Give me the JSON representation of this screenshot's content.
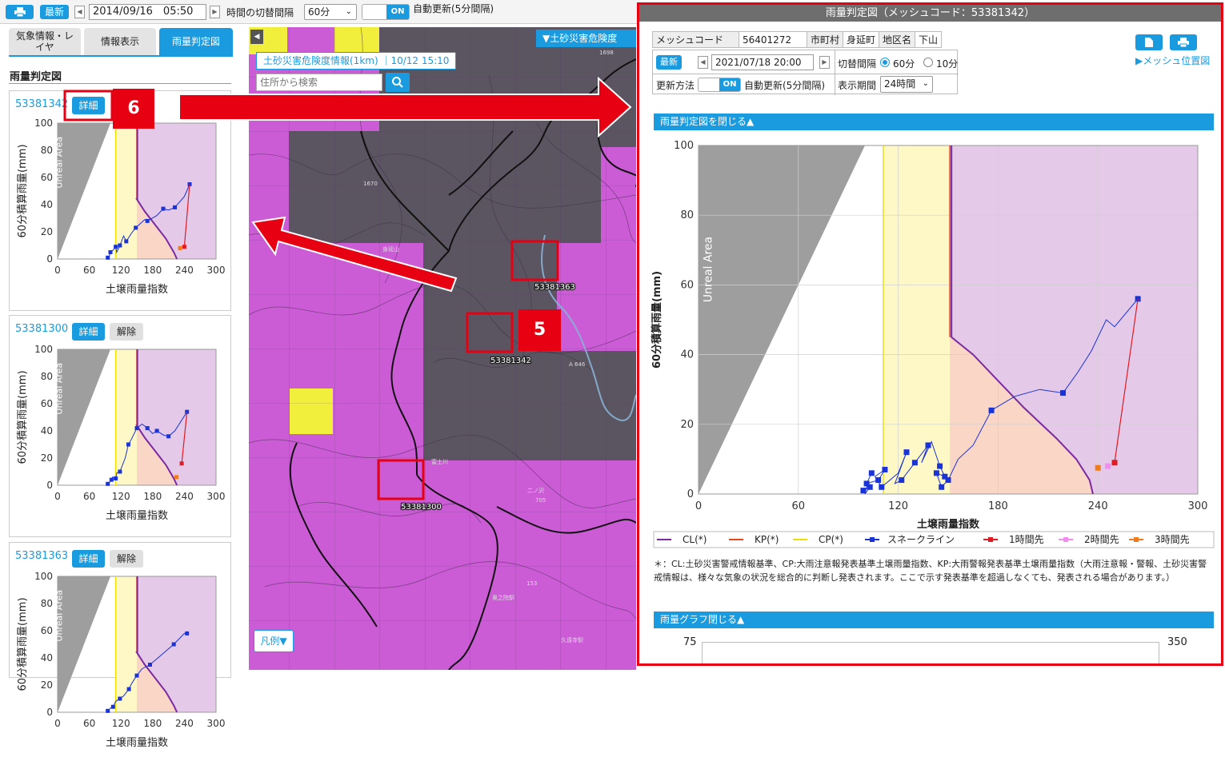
{
  "topbar": {
    "latest": "最新",
    "datetime": "2014/09/16　05:50",
    "interval_label": "時間の切替間隔",
    "interval_value": "60分",
    "toggle_on": "ON",
    "auto_update": "自動更新(5分間隔)"
  },
  "sidebar": {
    "tabs": [
      "気象情報・レイヤ",
      "情報表示",
      "雨量判定図"
    ],
    "section_title": "雨量判定図",
    "detail_label": "詳細",
    "release_label": "解除",
    "unreal_area": "Unreal Area",
    "ylabel": "60分積算雨量(mm)",
    "xlabel": "土壌雨量指数",
    "yticks": [
      "100",
      "80",
      "60",
      "40",
      "20",
      "0"
    ],
    "xticks": [
      "0",
      "60",
      "120",
      "180",
      "240",
      "300"
    ],
    "cards": [
      {
        "code": "53381342"
      },
      {
        "code": "53381300"
      },
      {
        "code": "53381363"
      }
    ]
  },
  "map": {
    "hazard_button": "▼土砂災害危険度",
    "info_label": "土砂災害危険度情報(1km) ｜10/12 15:10",
    "search_placeholder": "住所から検索",
    "legend_button": "凡例▼",
    "mesh_labels": [
      "53381363",
      "53381342",
      "53381300"
    ],
    "terrain_labels": [
      "1670",
      "1698",
      "A 646",
      "705",
      "153",
      "奥之院駅",
      "久遠寺駅",
      "身延山",
      "富士川",
      "二ノ沢"
    ],
    "colors": {
      "purple": "#cc5bd6",
      "dark": "#5a5560",
      "yellow": "#f2ee3c"
    }
  },
  "annotations": {
    "five": "5",
    "six": "6"
  },
  "panel": {
    "title": "雨量判定図（メッシュコード：53381342）",
    "mesh_code_label": "メッシュコード",
    "mesh_code_value": "56401272",
    "city_label": "市町村",
    "city_value": "身延町",
    "area_label": "地区名",
    "area_value": "下山",
    "latest": "最新",
    "datetime": "2021/07/18 20:00",
    "interval_label": "切替間隔",
    "interval_60": "60分",
    "interval_10": "10分",
    "update_label": "更新方法",
    "toggle_on": "ON",
    "auto_update": "自動更新(5分間隔)",
    "period_label": "表示期間",
    "period_value": "24時間",
    "mesh_position_link": "▶メッシュ位置図",
    "close_chart": "雨量判定図を閉じる▲",
    "close_graph": "雨量グラフ閉じる▲",
    "footnote": "＊：CL:土砂災害警戒情報基準、CP:大雨注意報発表基準土壌雨量指数、KP:大雨警報発表基準土壌雨量指数（大雨注意報・警報、土砂災害警戒情報は、様々な気象の状況を総合的に判断し発表されます。ここで示す発表基準を超過しなくても、発表される場合があります。）",
    "rain_graph_left_tick": "75",
    "rain_graph_right_tick": "350"
  },
  "chart_data": {
    "type": "line",
    "title": "",
    "xlabel": "土壌雨量指数",
    "ylabel": "60分積算雨量(mm)",
    "xlim": [
      0,
      300
    ],
    "ylim": [
      0,
      100
    ],
    "xticks": [
      0,
      60,
      120,
      180,
      240,
      300
    ],
    "yticks": [
      0,
      20,
      40,
      60,
      80,
      100
    ],
    "unreal_label": "Unreal Area",
    "cp_x": 111,
    "kp_x": 151,
    "cl_curve": [
      [
        152,
        45
      ],
      [
        165,
        40
      ],
      [
        177,
        34
      ],
      [
        195,
        25
      ],
      [
        215,
        16
      ],
      [
        227,
        10
      ],
      [
        235,
        4
      ],
      [
        237,
        0
      ]
    ],
    "snake_line": [
      [
        99,
        1
      ],
      [
        103,
        2
      ],
      [
        100,
        0
      ],
      [
        102,
        4
      ],
      [
        104,
        6
      ],
      [
        101,
        3
      ],
      [
        108,
        4
      ],
      [
        112,
        7
      ],
      [
        106,
        5
      ],
      [
        110,
        2
      ],
      [
        115,
        4
      ],
      [
        120,
        6
      ],
      [
        125,
        12
      ],
      [
        118,
        3
      ],
      [
        122,
        4
      ],
      [
        130,
        9
      ],
      [
        138,
        14
      ],
      [
        134,
        9
      ],
      [
        140,
        15
      ],
      [
        145,
        8
      ],
      [
        148,
        5
      ],
      [
        143,
        6
      ],
      [
        146,
        2
      ],
      [
        150,
        4
      ],
      [
        156,
        10
      ],
      [
        165,
        14
      ],
      [
        176,
        24
      ],
      [
        190,
        28
      ],
      [
        205,
        30
      ],
      [
        219,
        29
      ],
      [
        228,
        35
      ],
      [
        236,
        41
      ],
      [
        245,
        50
      ],
      [
        250,
        48
      ],
      [
        264,
        56
      ]
    ],
    "snake_markers": [
      [
        99,
        1
      ],
      [
        101,
        3
      ],
      [
        103,
        2
      ],
      [
        104,
        6
      ],
      [
        108,
        4
      ],
      [
        110,
        2
      ],
      [
        112,
        7
      ],
      [
        122,
        4
      ],
      [
        125,
        12
      ],
      [
        130,
        9
      ],
      [
        138,
        14
      ],
      [
        143,
        6
      ],
      [
        145,
        8
      ],
      [
        146,
        2
      ],
      [
        148,
        5
      ],
      [
        150,
        4
      ],
      [
        176,
        24
      ],
      [
        219,
        29
      ],
      [
        264,
        56
      ]
    ],
    "forecast_1h": [
      [
        264,
        56
      ],
      [
        250,
        9
      ]
    ],
    "forecast_2h": [
      [
        246,
        8
      ]
    ],
    "forecast_3h": [
      [
        240,
        7.5
      ]
    ],
    "legend": [
      "CL(*)",
      "KP(*)",
      "CP(*)",
      "スネークライン",
      "1時間先",
      "2時間先",
      "3時間先"
    ],
    "series_colors": {
      "CL": "#7b2aa0",
      "KP": "#e8471e",
      "CP": "#f0e000",
      "snake": "#1a33d6",
      "h1": "#e21a23",
      "h2": "#f28cf0",
      "h3": "#f07c1e",
      "unreal": "#9e9e9e",
      "cp_fill": "#fdf8c6",
      "kp_fill": "#f9d6c6",
      "cl_fill": "#e4c9e8"
    }
  },
  "mini_charts": [
    {
      "snake": [
        [
          95,
          1
        ],
        [
          98,
          2
        ],
        [
          100,
          5
        ],
        [
          104,
          6
        ],
        [
          110,
          9
        ],
        [
          112,
          5
        ],
        [
          118,
          10
        ],
        [
          125,
          17
        ],
        [
          130,
          13
        ],
        [
          140,
          19
        ],
        [
          148,
          23
        ],
        [
          165,
          29
        ],
        [
          170,
          28
        ],
        [
          188,
          32
        ],
        [
          200,
          37
        ],
        [
          210,
          36
        ],
        [
          222,
          38
        ],
        [
          240,
          46
        ],
        [
          250,
          55
        ]
      ],
      "h1": [
        [
          250,
          55
        ],
        [
          240,
          9
        ]
      ],
      "h3": [
        [
          232,
          8
        ]
      ]
    },
    {
      "snake": [
        [
          95,
          1
        ],
        [
          98,
          2
        ],
        [
          102,
          4
        ],
        [
          104,
          6
        ],
        [
          110,
          5
        ],
        [
          112,
          9
        ],
        [
          118,
          10
        ],
        [
          128,
          20
        ],
        [
          134,
          30
        ],
        [
          140,
          34
        ],
        [
          150,
          42
        ],
        [
          160,
          45
        ],
        [
          170,
          42
        ],
        [
          180,
          38
        ],
        [
          188,
          40
        ],
        [
          200,
          37
        ],
        [
          210,
          36
        ],
        [
          222,
          40
        ],
        [
          245,
          54
        ]
      ],
      "h1": [
        [
          245,
          54
        ],
        [
          235,
          16
        ]
      ],
      "h3": [
        [
          225,
          6
        ]
      ]
    },
    {
      "snake": [
        [
          95,
          1
        ],
        [
          100,
          3
        ],
        [
          105,
          4
        ],
        [
          110,
          8
        ],
        [
          118,
          10
        ],
        [
          125,
          12
        ],
        [
          135,
          17
        ],
        [
          140,
          21
        ],
        [
          150,
          27
        ],
        [
          160,
          32
        ],
        [
          175,
          35
        ],
        [
          190,
          40
        ],
        [
          220,
          50
        ],
        [
          240,
          58
        ],
        [
          245,
          58
        ]
      ],
      "h1": [],
      "h3": []
    }
  ]
}
